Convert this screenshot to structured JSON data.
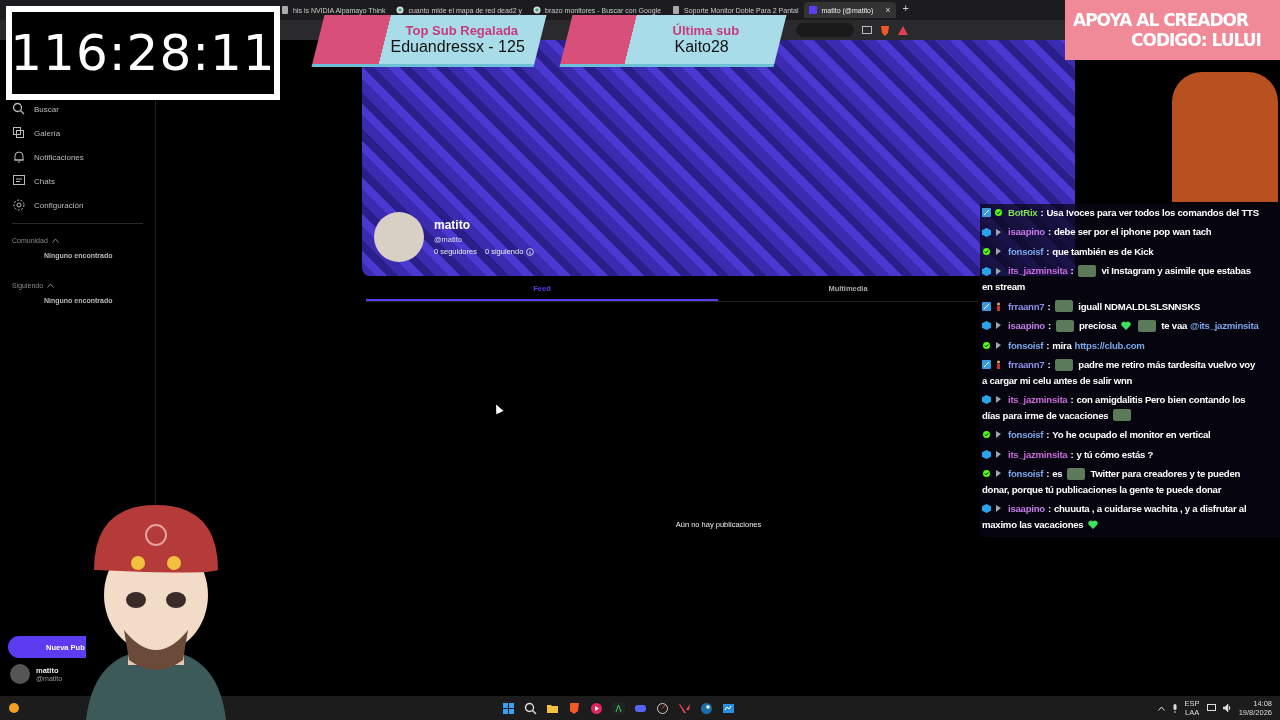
{
  "browser": {
    "tabs": [
      {
        "title": "his is NVIDIA Alpamayo Think",
        "selected": false
      },
      {
        "title": "cuanto mide el mapa de red dead2 y",
        "selected": false
      },
      {
        "title": "brazo monitores - Buscar con Google",
        "selected": false
      },
      {
        "title": "Soporte Monitor Doble Para 2 Pantal",
        "selected": false
      },
      {
        "title": "matito (@matito)",
        "selected": true
      }
    ],
    "new_tab": "+",
    "close_tab": "×"
  },
  "sidebar": {
    "items": [
      {
        "label": "Buscar",
        "selected": false
      },
      {
        "label": "Galería",
        "selected": false
      },
      {
        "label": "Notificaciones",
        "selected": false
      },
      {
        "label": "Chats",
        "selected": false
      },
      {
        "label": "Configuración",
        "selected": false
      }
    ],
    "sections": [
      {
        "title": "Comunidad",
        "expanded": true,
        "empty": "Ninguno encontrado"
      },
      {
        "title": "Siguiendo",
        "expanded": true,
        "empty": "Ninguno encontrado"
      }
    ],
    "new_post_button": "Nueva Pub",
    "account": {
      "name": "matito",
      "handle": "@matito"
    }
  },
  "profile": {
    "name": "matito",
    "handle": "@matito",
    "followers": "0 seguidores",
    "following": "0 siguiendo",
    "tabs": [
      {
        "label": "Feed",
        "selected": true
      },
      {
        "label": "Multimedia",
        "selected": false
      }
    ],
    "empty_message": "Aún no hay publicaciones"
  },
  "overlay": {
    "timer": "116:28:11",
    "banners": [
      {
        "title": "Top Sub Regalada",
        "value": "Eduandressx - 125"
      },
      {
        "title": "Última sub",
        "value": "Kaito28"
      }
    ],
    "promo": {
      "line_1": "APOYA AL CREADOR",
      "line_2": "CODIGO: LULUI"
    }
  },
  "chat": {
    "messages": [
      {
        "user": "BotRix",
        "color": "#7ee05a",
        "separator": ":",
        "badges": [
          {
            "kind": "bot"
          },
          {
            "kind": "verified"
          }
        ],
        "lines": [
          [
            {
              "kind": "text",
              "text": "Usa !voces para ver todos los comandos del TTS"
            }
          ]
        ]
      },
      {
        "user": "isaapino",
        "color": "#c67be8",
        "separator": ":",
        "badges": [
          {
            "kind": "cube"
          },
          {
            "kind": "pin"
          }
        ],
        "lines": [
          [
            {
              "kind": "text",
              "text": "debe ser por el iphone pop wan tach"
            }
          ]
        ]
      },
      {
        "user": "fonsoisf",
        "color": "#7aa6e8",
        "separator": ":",
        "badges": [
          {
            "kind": "verified"
          },
          {
            "kind": "pin"
          }
        ],
        "lines": [
          [
            {
              "kind": "text",
              "text": "que también es de Kick"
            }
          ]
        ]
      },
      {
        "user": "its_jazminsita",
        "color": "#c76ad8",
        "separator": ":",
        "badges": [
          {
            "kind": "cube"
          },
          {
            "kind": "pin"
          }
        ],
        "lines": [
          [
            {
              "kind": "emote"
            },
            {
              "kind": "text",
              "text": "vi Instagram y asimile que estabas"
            }
          ],
          [
            {
              "kind": "text",
              "text": "en stream"
            }
          ]
        ]
      },
      {
        "user": "frraann7",
        "color": "#8f8fe8",
        "separator": ":",
        "badges": [
          {
            "kind": "bot"
          },
          {
            "kind": "figure"
          }
        ],
        "lines": [
          [
            {
              "kind": "emote"
            },
            {
              "kind": "text",
              "text": "iguall NDMALDLSLSNNSKS"
            }
          ]
        ]
      },
      {
        "user": "isaapino",
        "color": "#c67be8",
        "separator": ":",
        "badges": [
          {
            "kind": "cube"
          },
          {
            "kind": "pin"
          }
        ],
        "lines": [
          [
            {
              "kind": "emote"
            },
            {
              "kind": "text",
              "text": "preciosa"
            },
            {
              "kind": "heart"
            },
            {
              "kind": "emote"
            },
            {
              "kind": "text",
              "text": "te vaa"
            },
            {
              "kind": "mention",
              "text": "@its_jazminsita"
            }
          ]
        ]
      },
      {
        "user": "fonsoisf",
        "color": "#7aa6e8",
        "separator": ":",
        "badges": [
          {
            "kind": "verified"
          },
          {
            "kind": "pin"
          }
        ],
        "lines": [
          [
            {
              "kind": "text",
              "text": "mira"
            },
            {
              "kind": "link",
              "text": "https://club.com"
            }
          ]
        ]
      },
      {
        "user": "frraann7",
        "color": "#8f8fe8",
        "separator": ":",
        "badges": [
          {
            "kind": "bot"
          },
          {
            "kind": "figure"
          }
        ],
        "lines": [
          [
            {
              "kind": "emote"
            },
            {
              "kind": "text",
              "text": "padre me retiro más tardesita vuelvo voy"
            }
          ],
          [
            {
              "kind": "text",
              "text": "a cargar mi celu antes de salir wnn"
            }
          ]
        ]
      },
      {
        "user": "its_jazminsita",
        "color": "#c76ad8",
        "separator": ":",
        "badges": [
          {
            "kind": "cube"
          },
          {
            "kind": "pin"
          }
        ],
        "lines": [
          [
            {
              "kind": "text",
              "text": "con amigdalitis Pero bien contando los"
            }
          ],
          [
            {
              "kind": "text",
              "text": "días para irme de vacaciones"
            },
            {
              "kind": "emote"
            }
          ]
        ]
      },
      {
        "user": "fonsoisf",
        "color": "#7aa6e8",
        "separator": ":",
        "badges": [
          {
            "kind": "verified"
          },
          {
            "kind": "pin"
          }
        ],
        "lines": [
          [
            {
              "kind": "text",
              "text": "Yo he ocupado el monitor en vertical"
            }
          ]
        ]
      },
      {
        "user": "its_jazminsita",
        "color": "#c76ad8",
        "separator": ":",
        "badges": [
          {
            "kind": "cube"
          },
          {
            "kind": "pin"
          }
        ],
        "lines": [
          [
            {
              "kind": "text",
              "text": "y tú cómo estás ?"
            }
          ]
        ]
      },
      {
        "user": "fonsoisf",
        "color": "#7aa6e8",
        "separator": ":",
        "badges": [
          {
            "kind": "verified"
          },
          {
            "kind": "pin"
          }
        ],
        "lines": [
          [
            {
              "kind": "text",
              "text": "es"
            },
            {
              "kind": "emote"
            },
            {
              "kind": "text",
              "text": "Twitter para creadores y te pueden"
            }
          ],
          [
            {
              "kind": "text",
              "text": "donar, porque tú publicaciones la gente te puede donar"
            }
          ]
        ]
      },
      {
        "user": "isaapino",
        "color": "#c67be8",
        "separator": ":",
        "badges": [
          {
            "kind": "cube"
          },
          {
            "kind": "pin"
          }
        ],
        "lines": [
          [
            {
              "kind": "text",
              "text": "chuuuta , a cuidarse wachita , y a disfrutar al"
            }
          ],
          [
            {
              "kind": "text",
              "text": "maximo las vacaciones"
            },
            {
              "kind": "heart"
            }
          ]
        ]
      }
    ]
  },
  "taskbar": {
    "language": "ESP",
    "layout": "LAA",
    "time": "14:08",
    "date": "19/8/2026"
  }
}
